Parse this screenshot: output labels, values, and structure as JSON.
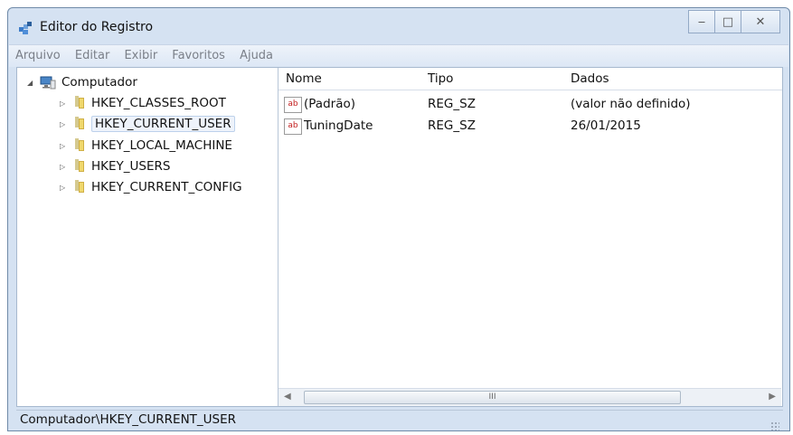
{
  "window": {
    "title": "Editor do Registro"
  },
  "menu": {
    "items": [
      "Arquivo",
      "Editar",
      "Exibir",
      "Favoritos",
      "Ajuda"
    ]
  },
  "tree": {
    "root": "Computador",
    "items": [
      {
        "label": "HKEY_CLASSES_ROOT",
        "selected": false
      },
      {
        "label": "HKEY_CURRENT_USER",
        "selected": true
      },
      {
        "label": "HKEY_LOCAL_MACHINE",
        "selected": false
      },
      {
        "label": "HKEY_USERS",
        "selected": false
      },
      {
        "label": "HKEY_CURRENT_CONFIG",
        "selected": false
      }
    ]
  },
  "list": {
    "headers": [
      "Nome",
      "Tipo",
      "Dados"
    ],
    "rows": [
      {
        "name": "(Padrão)",
        "type": "REG_SZ",
        "data": "(valor não definido)"
      },
      {
        "name": "TuningDate",
        "type": "REG_SZ",
        "data": "26/01/2015"
      }
    ]
  },
  "scrollbar": {
    "thumb_label": "III"
  },
  "status": {
    "path": "Computador\\HKEY_CURRENT_USER"
  }
}
